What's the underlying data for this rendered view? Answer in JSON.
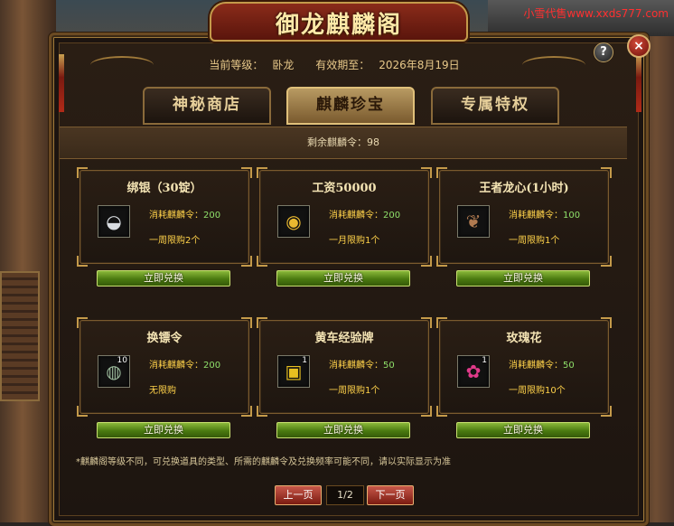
{
  "window": {
    "title": "御龙麒麟阁",
    "watermark": "小雪代售www.xxds777.com",
    "help_label": "?",
    "close_label": "×"
  },
  "header": {
    "level_label": "当前等级：",
    "level_value": "卧龙",
    "expiry_label": "有效期至：",
    "expiry_value": "2026年8月19日"
  },
  "tabs": [
    {
      "label": "神秘商店",
      "active": false
    },
    {
      "label": "麒麟珍宝",
      "active": true
    },
    {
      "label": "专属特权",
      "active": false
    }
  ],
  "remaining": {
    "label": "剩余麒麟令：",
    "value": "98"
  },
  "items": [
    {
      "name": "绑银（30锭）",
      "icon": "silver-ingot-icon",
      "qty": "",
      "cost_label": "消耗麒麟令：",
      "cost": "200",
      "limit": "一周限购2个"
    },
    {
      "name": "工资50000",
      "icon": "gold-coins-icon",
      "qty": "",
      "cost_label": "消耗麒麟令：",
      "cost": "200",
      "limit": "一月限购1个"
    },
    {
      "name": "王者龙心(1小时)",
      "icon": "dragon-heart-icon",
      "qty": "",
      "cost_label": "消耗麒麟令：",
      "cost": "100",
      "limit": "一周限购1个"
    },
    {
      "name": "换镖令",
      "icon": "escort-token-icon",
      "qty": "10",
      "cost_label": "消耗麒麟令：",
      "cost": "200",
      "limit": "无限购"
    },
    {
      "name": "黄车经验牌",
      "icon": "yellow-cart-icon",
      "qty": "1",
      "cost_label": "消耗麒麟令：",
      "cost": "50",
      "limit": "一周限购1个"
    },
    {
      "name": "玫瑰花",
      "icon": "rose-icon",
      "qty": "1",
      "cost_label": "消耗麒麟令：",
      "cost": "50",
      "limit": "一周限购10个"
    }
  ],
  "redeem_label": "立即兑换",
  "note": "*麒麟阁等级不同，可兑换道具的类型、所需的麒麟令及兑换频率可能不同，请以实际显示为准",
  "pager": {
    "prev_label": "上一页",
    "page": "1/2",
    "next_label": "下一页"
  },
  "colors": {
    "accent_gold": "#e8c98a",
    "cost_green": "#8fe06a",
    "redeem_green": "#4a7a10",
    "pager_red": "#7a1a10"
  }
}
